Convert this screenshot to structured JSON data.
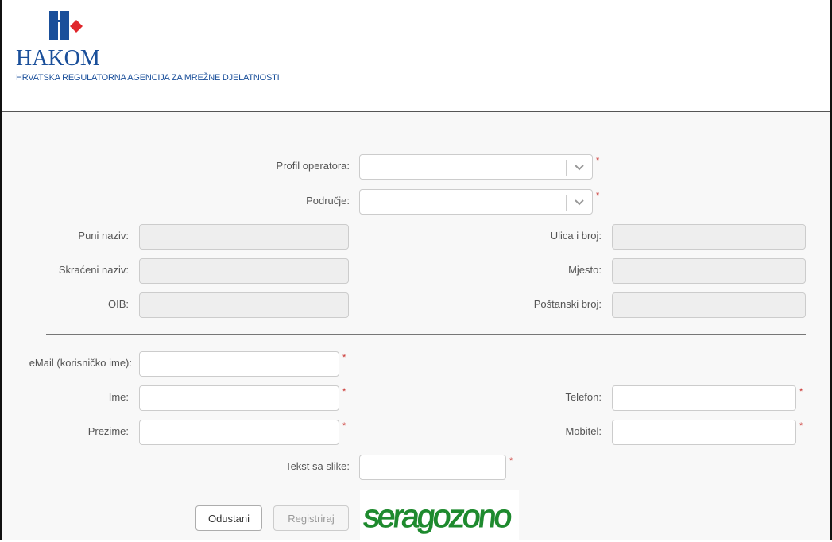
{
  "header": {
    "brand_name": "HAKOM",
    "brand_subtitle": "HRVATSKA REGULATORNA AGENCIJA ZA MREŽNE DJELATNOSTI",
    "logo_colors": {
      "blue": "#1a4f9a",
      "red": "#e0262b"
    }
  },
  "form": {
    "required_mark": "*",
    "profil_operatora": {
      "label": "Profil operatora:",
      "value": ""
    },
    "podrucje": {
      "label": "Područje:",
      "value": ""
    },
    "puni_naziv": {
      "label": "Puni naziv:",
      "value": ""
    },
    "skraceni_naziv": {
      "label": "Skraćeni naziv:",
      "value": ""
    },
    "oib": {
      "label": "OIB:",
      "value": ""
    },
    "ulica_i_broj": {
      "label": "Ulica i broj:",
      "value": ""
    },
    "mjesto": {
      "label": "Mjesto:",
      "value": ""
    },
    "postanski_broj": {
      "label": "Poštanski broj:",
      "value": ""
    },
    "email": {
      "label": "eMail (korisničko ime):",
      "value": ""
    },
    "ime": {
      "label": "Ime:",
      "value": ""
    },
    "prezime": {
      "label": "Prezime:",
      "value": ""
    },
    "telefon": {
      "label": "Telefon:",
      "value": ""
    },
    "mobitel": {
      "label": "Mobitel:",
      "value": ""
    },
    "tekst_sa_slike": {
      "label": "Tekst sa slike:",
      "value": ""
    }
  },
  "buttons": {
    "cancel_label": "Odustani",
    "register_label": "Registriraj"
  },
  "captcha": {
    "text": "seragozono",
    "color": "#1e8a2e"
  }
}
